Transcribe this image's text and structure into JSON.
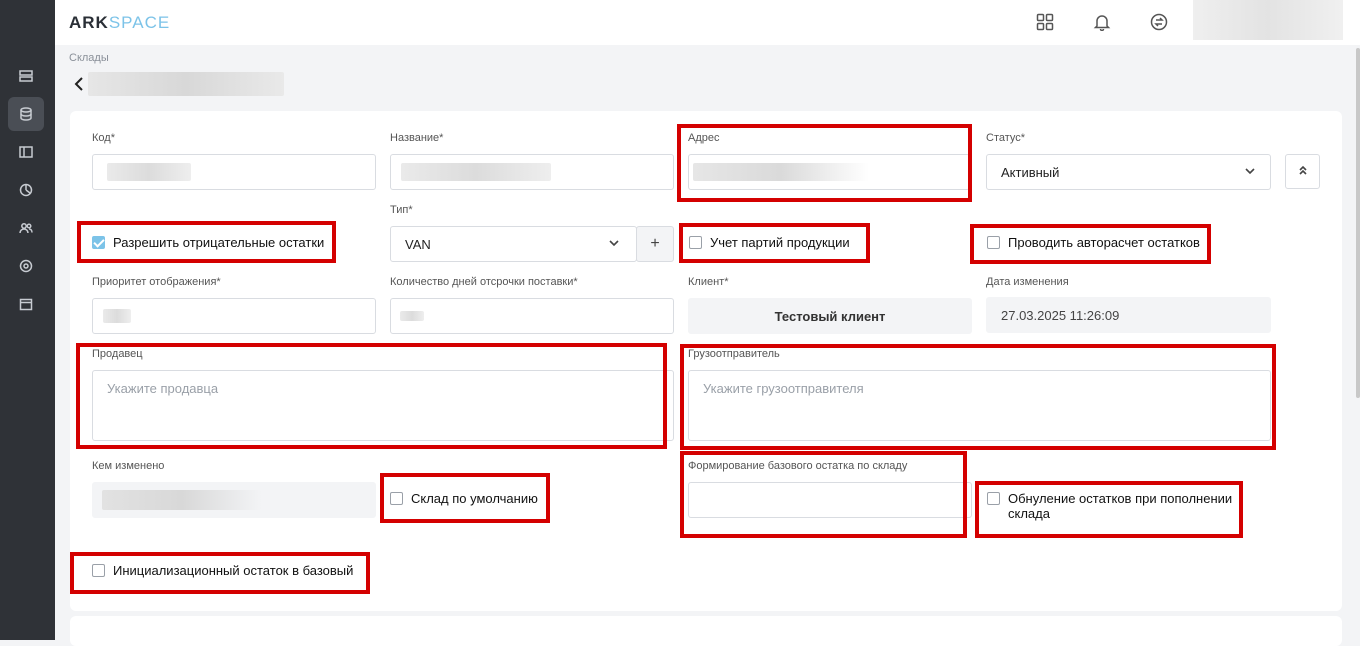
{
  "logo": {
    "ark": "ARK",
    "space": "SPACE"
  },
  "sidebar": {
    "items": [
      {
        "icon": "server-icon"
      },
      {
        "icon": "database-icon",
        "active": true
      },
      {
        "icon": "layout-icon"
      },
      {
        "icon": "pie-chart-icon"
      },
      {
        "icon": "users-icon"
      },
      {
        "icon": "settings-icon"
      },
      {
        "icon": "calendar-icon"
      }
    ]
  },
  "topbar": {
    "icons": [
      "apps-grid-icon",
      "bell-icon",
      "sync-icon"
    ]
  },
  "breadcrumb": "Склады",
  "form": {
    "code_label": "Код*",
    "name_label": "Название*",
    "address_label": "Адрес",
    "status_label": "Статус*",
    "status_value": "Активный",
    "type_label": "Тип*",
    "type_value": "VAN",
    "type_add": "+",
    "allow_negative": {
      "label": "Разрешить отрицательные остатки",
      "checked": true
    },
    "batch_accounting": {
      "label": "Учет партий продукции",
      "checked": false
    },
    "auto_calc": {
      "label": "Проводить авторасчет остатков",
      "checked": false
    },
    "priority_label": "Приоритет отображения*",
    "delay_days_label": "Количество дней отсрочки поставки*",
    "client_label": "Клиент*",
    "client_value": "Тестовый клиент",
    "modified_date_label": "Дата изменения",
    "modified_date_value": "27.03.2025 11:26:09",
    "seller_label": "Продавец",
    "seller_placeholder": "Укажите продавца",
    "shipper_label": "Грузоотправитель",
    "shipper_placeholder": "Укажите грузоотправителя",
    "modified_by_label": "Кем изменено",
    "default_warehouse": {
      "label": "Склад по умолчанию",
      "checked": false
    },
    "base_stock_label": "Формирование базового остатка по складу",
    "reset_on_replenish": {
      "label": "Обнуление остатков при пополнении склада",
      "checked": false
    },
    "init_stock_base": {
      "label": "Инициализационный остаток в базовый",
      "checked": false
    }
  },
  "colors": {
    "highlight": "#d40000",
    "accent": "#7cc3e8",
    "sidebar": "#2f3237"
  }
}
